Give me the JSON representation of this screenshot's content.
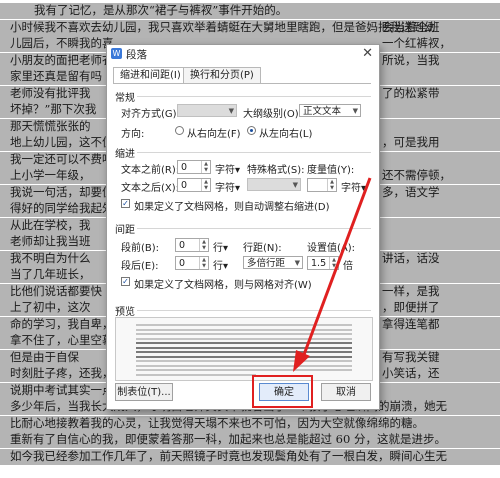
{
  "document": {
    "lines": [
      "我有了记忆，是从那次“裙子与裤衩”事件开始的。",
      "小时候我不喜欢去幼儿园，我只喜欢举着蜻蜓在大舅地里瞎跑，但是爸妈把我送到幼",
      "儿园后，不瞬我的喜",
      "小朋友的面把老师衣",
      "家里还真是留有吗",
      "老师没有批评我",
      "坏掉？”那下次我",
      "那天慌慌张张的",
      "地上幼儿园，这不仿",
      "我一定还可以不费吵",
      "上小学一年级，",
      "我说一句活，却要仿",
      "得好的同学给我起外",
      "从此在学校，我",
      "老师却让我当班",
      "我不明白为什么",
      "当了几年班长，",
      "比他们说话都要快",
      "上了初中，这次",
      "命的学习，我自卑，",
      "拿不住了，心里空慕",
      "但是由于自保",
      "时刻肚子疼，还我，",
      "说期中考试其实一点",
      "多少年后，当我长大成人，才明白老师其实早就看出了一个孩子心理瞬间的崩溃，她无",
      "比耐心地接教着我的心灵，让我觉得天塌不来也不可怕，因为大空就像绵绵的糖。",
      "重新有了自信心的我，即便蒙着答那一科，加起来也总是能超过 60 分，这就是进步。",
      "如今我已经参加工作几年了，前天照镜子时竟也发现鬓角处有了一根白发，瞬间心生无"
    ],
    "right_fragments": [
      "了的松紧带",
      "，可是我用",
      "还不需停顿，",
      "多，语文学",
      "讲话，话没",
      "一样，是我",
      "，即便拼了",
      "拿得连笔都",
      "有写我关键",
      "小笑话，还",
      "所说，当我",
      "一个红裤衩，",
      "会当着全班"
    ]
  },
  "dialog": {
    "title": "段落",
    "tabs": [
      "缩进和间距(I)",
      "换行和分页(P)"
    ],
    "general": {
      "heading": "常规",
      "align_label": "对齐方式(G):",
      "align_value": "",
      "outline_label": "大纲级别(O):",
      "outline_value": "正文文本",
      "direction_label": "方向:",
      "rtl_label": "从右向左(F)",
      "ltr_label": "从左向右(L)"
    },
    "indent": {
      "heading": "缩进",
      "before_label": "文本之前(R):",
      "before_value": "0",
      "before_unit": "字符",
      "after_label": "文本之后(X):",
      "after_value": "0",
      "after_unit": "字符",
      "special_label": "特殊格式(S):",
      "special_value": "",
      "measure_label": "度量值(Y):",
      "measure_value": "",
      "measure_unit": "字符",
      "grid_label": "如果定义了文档网格，则自动调整右缩进(D)"
    },
    "spacing": {
      "heading": "间距",
      "before_label": "段前(B):",
      "before_value": "0",
      "before_unit": "行",
      "after_label": "段后(E):",
      "after_value": "0",
      "after_unit": "行",
      "line_label": "行距(N):",
      "line_value": "多倍行距",
      "at_label": "设置值(A):",
      "at_value": "1.5",
      "at_unit": "倍",
      "grid_label": "如果定义了文档网格，则与网格对齐(W)"
    },
    "preview_label": "预览",
    "tabs_button": "制表位(T)...",
    "ok_button": "确定",
    "cancel_button": "取消"
  },
  "colors": {
    "highlight": "#e02020",
    "selection": "#b4b4b4"
  }
}
